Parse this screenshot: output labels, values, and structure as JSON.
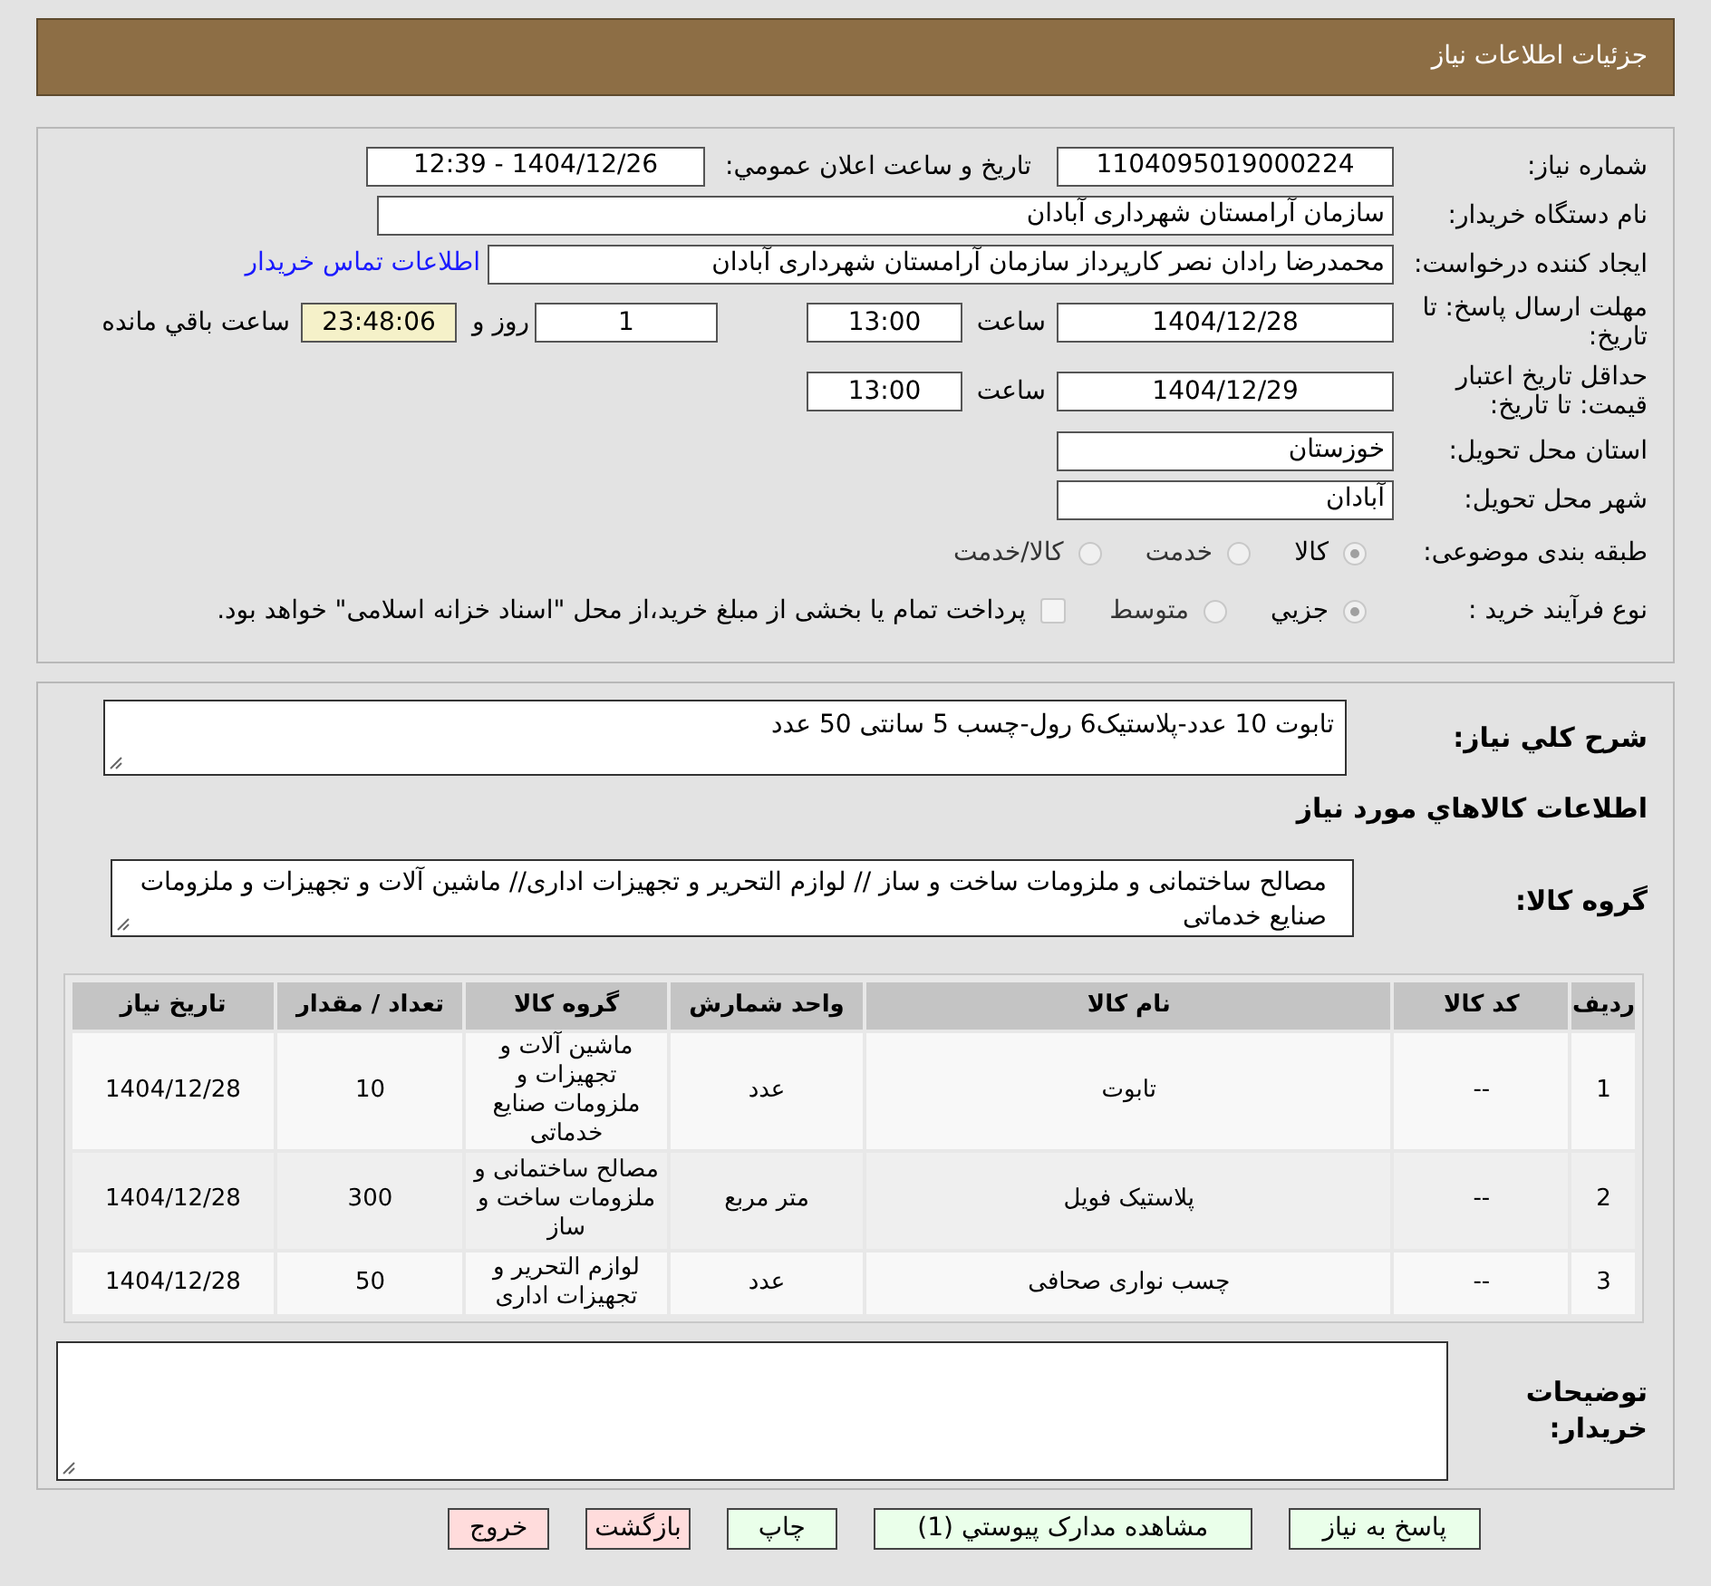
{
  "header": {
    "title": "جزئیات اطلاعات نیاز"
  },
  "need_info": {
    "need_number": {
      "label": "شماره نیاز:",
      "value": "1104095019000224"
    },
    "announce": {
      "label": "تاریخ و ساعت اعلان عمومي:",
      "value": "1404/12/26 - 12:39"
    },
    "buyer": {
      "label": "نام دستگاه خریدار:",
      "value": "سازمان آرامستان شهرداری آبادان"
    },
    "requester": {
      "label": "ایجاد کننده درخواست:",
      "value": "محمدرضا رادان نصر کارپرداز سازمان آرامستان شهرداری آبادان",
      "link": "اطلاعات تماس خریدار"
    },
    "deadline": {
      "label": "مهلت ارسال پاسخ: تا تاریخ:",
      "date": "1404/12/28",
      "time_label": "ساعت",
      "time": "13:00",
      "days": "1",
      "days_label": "روز و",
      "remaining": "23:48:06",
      "remaining_label": "ساعت باقي مانده"
    },
    "validity": {
      "label": "حداقل تاریخ اعتبار قیمت: تا تاریخ:",
      "date": "1404/12/29",
      "time_label": "ساعت",
      "time": "13:00"
    },
    "province": {
      "label": "استان محل تحویل:",
      "value": "خوزستان"
    },
    "city": {
      "label": "شهر محل تحویل:",
      "value": "آبادان"
    },
    "category": {
      "label": "طبقه بندی موضوعی:",
      "options": [
        {
          "label": "کالا",
          "selected": true
        },
        {
          "label": "خدمت",
          "selected": false
        },
        {
          "label": "کالا/خدمت",
          "selected": false
        }
      ]
    },
    "process": {
      "label": "نوع فرآیند خرید :",
      "options": [
        {
          "label": "جزيي",
          "selected": true
        },
        {
          "label": "متوسط",
          "selected": false
        }
      ],
      "payment": {
        "label": "پرداخت تمام یا بخشی از مبلغ خرید،از محل \"اسناد خزانه اسلامی\" خواهد بود.",
        "checked": false
      }
    }
  },
  "goods": {
    "description": {
      "label": "شرح کلي نیاز:",
      "value": "تابوت 10 عدد-پلاستیک6 رول-چسب 5 سانتی 50 عدد"
    },
    "heading": "اطلاعات کالاهاي مورد نیاز",
    "group": {
      "label": "گروه کالا:",
      "value": "مصالح ساختمانی و ملزومات ساخت و ساز // لوازم التحریر و تجهیزات اداری// ماشین آلات و تجهیزات و ملزومات صنایع خدماتی"
    },
    "table": {
      "columns": [
        "ردیف",
        "کد کالا",
        "نام کالا",
        "واحد شمارش",
        "گروه کالا",
        "تعداد / مقدار",
        "تاریخ نیاز"
      ],
      "rows": [
        [
          "1",
          "--",
          "تابوت",
          "عدد",
          "ماشین آلات و تجهیزات و ملزومات صنایع خدماتی",
          "10",
          "1404/12/28"
        ],
        [
          "2",
          "--",
          "پلاستیک فویل",
          "متر مربع",
          "مصالح ساختمانی و ملزومات ساخت و ساز",
          "300",
          "1404/12/28"
        ],
        [
          "3",
          "--",
          "چسب نواری صحافی",
          "عدد",
          "لوازم التحریر و تجهیزات اداری",
          "50",
          "1404/12/28"
        ]
      ]
    },
    "buyer_notes": {
      "label": "توضیحات خریدار:"
    }
  },
  "buttons": [
    {
      "label": "پاسخ به نیاز",
      "kind": "green"
    },
    {
      "label": "مشاهده مدارک پیوستي (1)",
      "kind": "green"
    },
    {
      "label": "چاپ",
      "kind": "green"
    },
    {
      "label": "بازگشت",
      "kind": "red"
    },
    {
      "label": "خروج",
      "kind": "red"
    }
  ]
}
